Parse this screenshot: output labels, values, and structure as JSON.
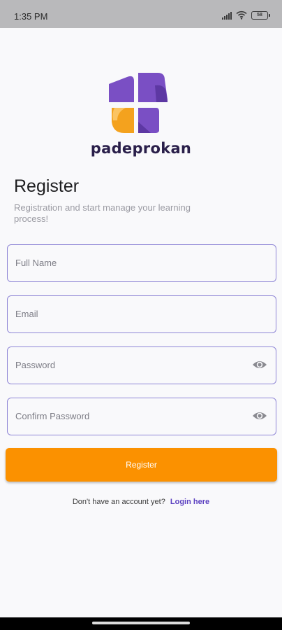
{
  "status_bar": {
    "time": "1:35 PM",
    "battery": "58"
  },
  "brand": {
    "name": "padeprokan",
    "colors": {
      "purple": "#7a4fc4",
      "orange": "#f4a21e",
      "text": "#2a1f4a"
    }
  },
  "header": {
    "title": "Register",
    "subtitle": "Registration and start manage your learning process!"
  },
  "form": {
    "full_name": {
      "placeholder": "Full Name"
    },
    "email": {
      "placeholder": "Email"
    },
    "password": {
      "placeholder": "Password",
      "icon": "eye-icon"
    },
    "confirm_password": {
      "placeholder": "Confirm Password",
      "icon": "eye-icon"
    },
    "submit_label": "Register",
    "accent_color": "#fb9100",
    "border_color": "#8f86d6"
  },
  "footer": {
    "prompt": "Don't have an account yet?",
    "link_label": "Login here"
  }
}
